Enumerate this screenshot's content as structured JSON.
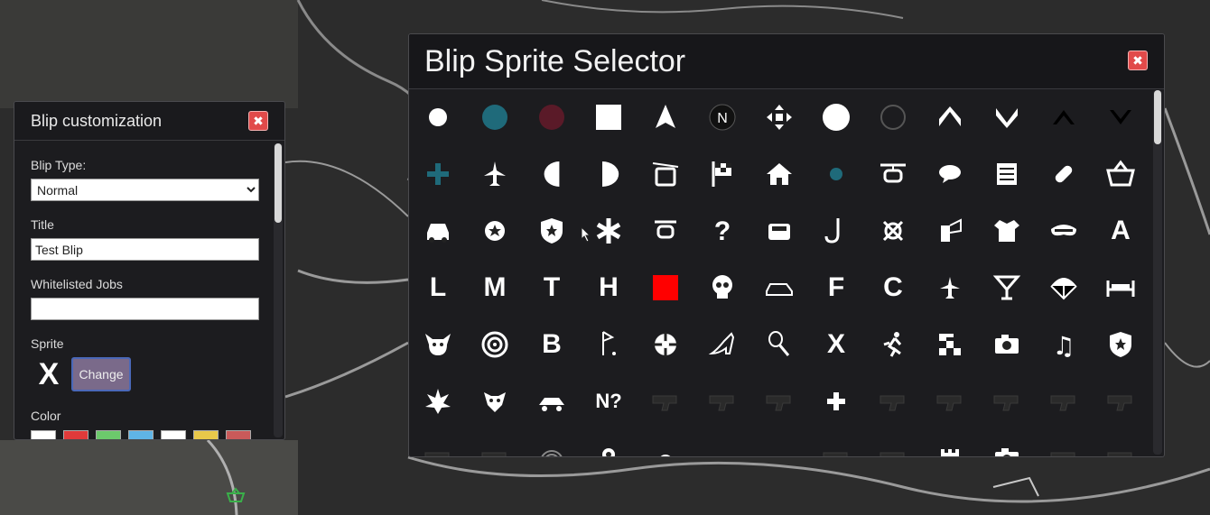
{
  "customization": {
    "title": "Blip customization",
    "close_label": "✖",
    "blip_type": {
      "label": "Blip Type:",
      "value": "Normal",
      "options": [
        "Normal"
      ]
    },
    "title_field": {
      "label": "Title",
      "value": "Test Blip"
    },
    "jobs_field": {
      "label": "Whitelisted Jobs",
      "value": ""
    },
    "sprite": {
      "label": "Sprite",
      "preview": "X",
      "change_label": "Change"
    },
    "color": {
      "label": "Color",
      "swatches": [
        "#ffffff",
        "#e03a3a",
        "#6cc96c",
        "#5fb4e6",
        "#ffffff",
        "#e8c84a",
        "#c95a5a"
      ]
    }
  },
  "selector": {
    "title": "Blip Sprite Selector",
    "close_label": "✖",
    "rows": [
      [
        "dot",
        "dot-teal",
        "dot-maroon",
        "square",
        "arrow-up",
        "north",
        "move",
        "circle",
        "ring",
        "chevron-up",
        "chevron-down",
        "caret-up-dark",
        "caret-down-dark"
      ],
      [
        "plus-teal",
        "plane",
        "half-left",
        "half-right",
        "cable-car",
        "flag",
        "house",
        "dot-teal-small",
        "helicopter",
        "speech",
        "list",
        "pill",
        "basket"
      ],
      [
        "car",
        "star",
        "shield",
        "asterisk",
        "heli-small",
        "question",
        "car-front",
        "hook",
        "ribbon",
        "flag-box",
        "shirt",
        "mask",
        "A"
      ],
      [
        "L",
        "M",
        "T",
        "H",
        "square-red",
        "skull",
        "car-side",
        "F",
        "C",
        "plane-small",
        "cocktail",
        "parachute",
        "bed"
      ],
      [
        "bull",
        "target",
        "B",
        "golf",
        "crosshair",
        "heel",
        "tennis",
        "X",
        "runner",
        "checker",
        "camera",
        "music",
        "badge"
      ],
      [
        "leaf",
        "bulldog",
        "buggy",
        "N?",
        "gun-dark",
        "gun-dark",
        "gun-dark",
        "plus",
        "gun-dark",
        "gun-dark",
        "gun-dark",
        "gun-dark",
        "gun-dark"
      ],
      [
        "gun-dark",
        "gun-dark",
        "rings",
        "pin",
        "ring-small",
        "tag",
        "smile",
        "gun-dark",
        "gun-dark",
        "castle",
        "camera",
        "gun-dark",
        "gun-dark"
      ]
    ],
    "letters": [
      "A",
      "L",
      "M",
      "T",
      "H",
      "F",
      "C",
      "B",
      "X",
      "N?"
    ],
    "glyphs": {
      "question": "?",
      "plus": "+",
      "north": "N",
      "music": "♫",
      "runner": "🏃"
    },
    "colors": {
      "white": "#ffffff",
      "teal": "#1f6a7a",
      "maroon": "#5a1a28",
      "red": "#ff0000",
      "dark": "#2a2a2a"
    }
  }
}
